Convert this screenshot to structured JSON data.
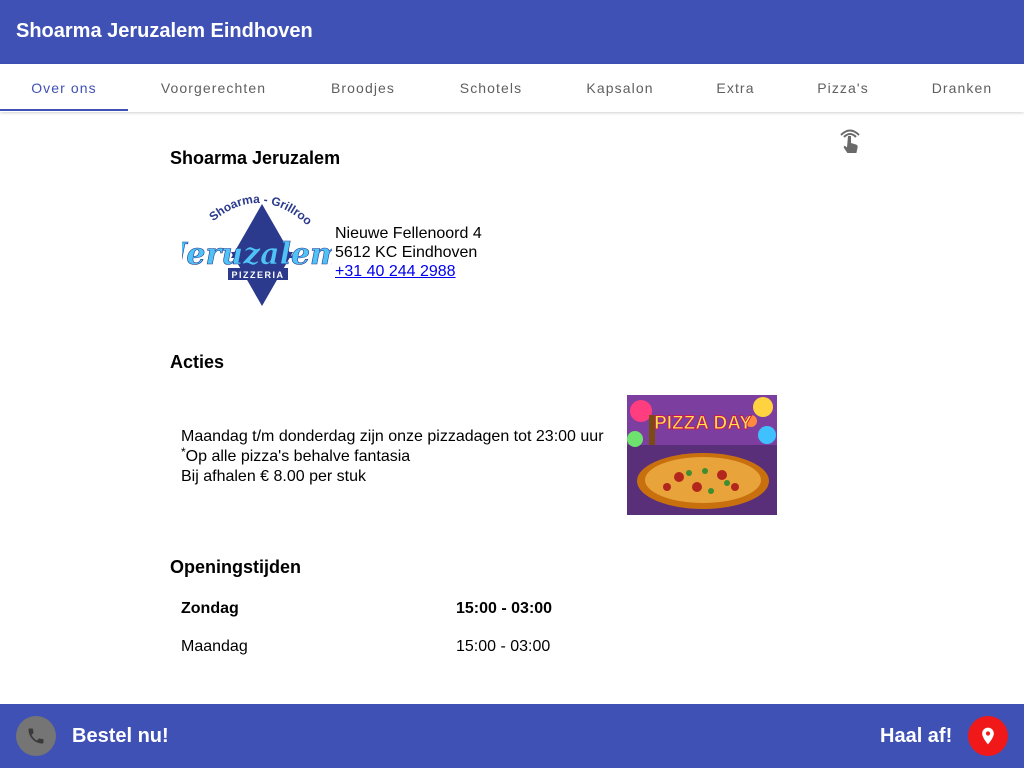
{
  "appbar": {
    "title": "Shoarma Jeruzalem Eindhoven"
  },
  "tabs": [
    {
      "label": "Over ons",
      "active": true
    },
    {
      "label": "Voorgerechten"
    },
    {
      "label": "Broodjes"
    },
    {
      "label": "Schotels"
    },
    {
      "label": "Kapsalon"
    },
    {
      "label": "Extra"
    },
    {
      "label": "Pizza's"
    },
    {
      "label": "Dranken"
    }
  ],
  "colors": {
    "primary": "#3f51b5",
    "call_button": "#757575",
    "location_button": "#f01818",
    "link": "#0000ee"
  },
  "icons": {
    "swipe": "swipe-icon",
    "phone": "phone-icon",
    "location": "location-pin-icon"
  },
  "about": {
    "heading": "Shoarma Jeruzalem",
    "logo": {
      "top_text": "Shoarma - Grillroom",
      "name": "Jeruzalem",
      "bottom_text": "PIZZERIA"
    },
    "address_line1": "Nieuwe Fellenoord 4",
    "address_line2": "5612 KC Eindhoven",
    "phone": "+31 40 244 2988"
  },
  "actions": {
    "heading": "Acties",
    "line1": "Maandag t/m donderdag zijn onze pizzadagen tot 23:00 uur",
    "asterisk": "*",
    "line2": "Op alle pizza's behalve fantasia",
    "line3": "Bij afhalen € 8.00 per stuk",
    "image_text": "PIZZA DAY"
  },
  "hours": {
    "heading": "Openingstijden",
    "rows": [
      {
        "day": "Zondag",
        "time": "15:00 - 03:00",
        "today": true
      },
      {
        "day": "Maandag",
        "time": "15:00 - 03:00"
      }
    ]
  },
  "bottombar": {
    "order_label": "Bestel nu!",
    "pickup_label": "Haal af!"
  }
}
